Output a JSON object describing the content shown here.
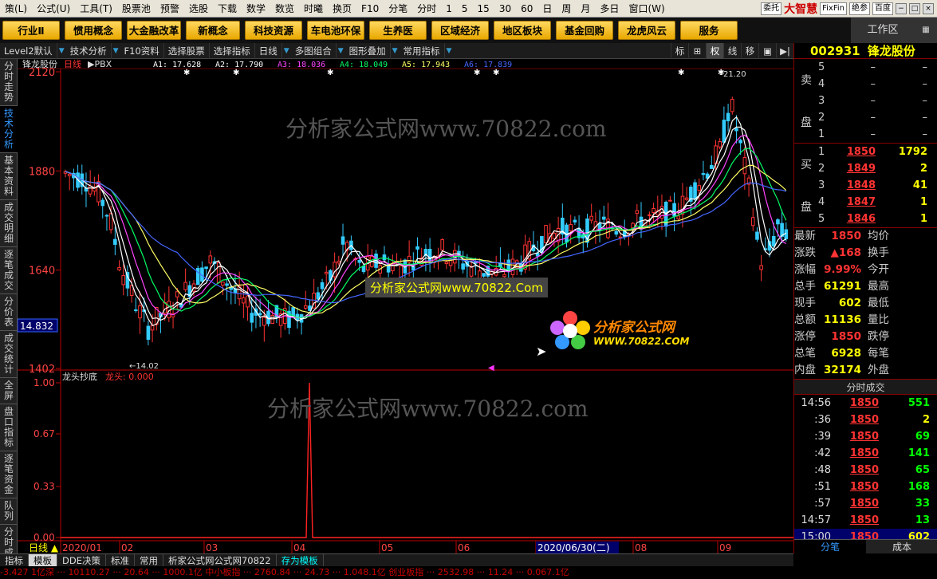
{
  "menu": [
    "策(L)",
    "公式(U)",
    "工具(T)",
    "股票池",
    "预警",
    "选股",
    "下载",
    "数学",
    "数览",
    "时曦",
    "换页",
    "F10",
    "分笔",
    "分时",
    "1",
    "5",
    "15",
    "30",
    "60",
    "日",
    "周",
    "月",
    "多日",
    "窗口(W)"
  ],
  "menu_badges": [
    "委托",
    "大智慧",
    "FixFin",
    "绝参",
    "百度"
  ],
  "toolbar": [
    "行业Ⅱ",
    "惯用概念",
    "大金融改革",
    "新概念",
    "科技资源",
    "车电池环保",
    "生养医",
    "区域经济",
    "地区板块",
    "基金回购",
    "龙虎风云",
    "服务"
  ],
  "workspace": "工作区",
  "subbar": {
    "items": [
      "Level2默认",
      "技术分析",
      "F10资料",
      "选择股票",
      "选择指标",
      "日线",
      "多图组合",
      "图形叠加",
      "常用指标"
    ],
    "right_buttons": [
      "标",
      "⊞",
      "权",
      "线",
      "移",
      "▣",
      "▶|"
    ]
  },
  "left_tabs": [
    "分时走势",
    "技术分析",
    "基本资料",
    "成交明细",
    "逐笔成交",
    "分价表",
    "成交统计",
    "全屏",
    "盘口指标",
    "逐笔资金",
    "队列",
    "分时成交"
  ],
  "chart": {
    "stock_name": "锋龙股份",
    "period": "日线",
    "indicator": "PBX",
    "ma_legend": [
      {
        "label": "A1: 17.628",
        "color": "#ffffff"
      },
      {
        "label": "A2: 17.790",
        "color": "#ffffff"
      },
      {
        "label": "A3: 18.036",
        "color": "#ff44ff"
      },
      {
        "label": "A4: 18.049",
        "color": "#00ff66"
      },
      {
        "label": "A5: 17.943",
        "color": "#ffff66"
      },
      {
        "label": "A6: 17.839",
        "color": "#4466ff"
      }
    ],
    "price_axis": [
      "2120",
      "1880",
      "1640",
      "1402"
    ],
    "current_price_tag": "14.832",
    "high_label": "21.20",
    "low_label": "14.02",
    "date_axis": [
      "2020/01",
      "02",
      "03",
      "04",
      "05",
      "06",
      "07",
      "08",
      "09"
    ],
    "cursor_date": "2020/06/30(二)",
    "sub_title": "龙头抄底",
    "sub_indicator": "龙头: 0.000",
    "sub_axis": [
      "1.00",
      "0.67",
      "0.33",
      "0.00"
    ],
    "period_label": "日线"
  },
  "chart_data": {
    "type": "candlestick",
    "title": "锋龙股份 日线 PBX",
    "ylim": [
      14.02,
      21.2
    ],
    "x": [
      "2020/01",
      "02",
      "03",
      "04",
      "05",
      "06",
      "07",
      "08",
      "09"
    ],
    "series": [
      {
        "name": "A1",
        "value": 17.628
      },
      {
        "name": "A2",
        "value": 17.79
      },
      {
        "name": "A3",
        "value": 18.036
      },
      {
        "name": "A4",
        "value": 18.049
      },
      {
        "name": "A5",
        "value": 17.943
      },
      {
        "name": "A6",
        "value": 17.839
      }
    ],
    "sub_chart": {
      "type": "line",
      "name": "龙头",
      "ylim": [
        0,
        1
      ],
      "values_note": "single spike to 1.00 in early April"
    }
  },
  "watermarks": {
    "main": "分析家公式网www.70822.com",
    "box": "分析家公式网www.70822.Com",
    "logo_title": "分析家公式网",
    "logo_url": "WWW.70822.COM"
  },
  "quote": {
    "code": "002931",
    "name": "锋龙股份",
    "sell_label": [
      "卖",
      "盘"
    ],
    "buy_label": [
      "买",
      "盘"
    ],
    "sell": [
      {
        "lv": "5",
        "price": "–",
        "vol": "–"
      },
      {
        "lv": "4",
        "price": "–",
        "vol": "–"
      },
      {
        "lv": "3",
        "price": "–",
        "vol": "–"
      },
      {
        "lv": "2",
        "price": "–",
        "vol": "–"
      },
      {
        "lv": "1",
        "price": "–",
        "vol": "–"
      }
    ],
    "buy": [
      {
        "lv": "1",
        "price": "1850",
        "vol": "1792"
      },
      {
        "lv": "2",
        "price": "1849",
        "vol": "2"
      },
      {
        "lv": "3",
        "price": "1848",
        "vol": "41"
      },
      {
        "lv": "4",
        "price": "1847",
        "vol": "1"
      },
      {
        "lv": "5",
        "price": "1846",
        "vol": "1"
      }
    ],
    "stats": [
      {
        "k": "最新",
        "v": "1850",
        "vc": "red",
        "k2": "均价"
      },
      {
        "k": "涨跌",
        "v": "▲168",
        "vc": "red",
        "k2": "换手"
      },
      {
        "k": "涨幅",
        "v": "9.99%",
        "vc": "red",
        "k2": "今开"
      },
      {
        "k": "总手",
        "v": "61291",
        "vc": "yel",
        "k2": "最高"
      },
      {
        "k": "现手",
        "v": "602",
        "vc": "yel",
        "k2": "最低"
      },
      {
        "k": "总额",
        "v": "11136",
        "vc": "yel",
        "k2": "量比"
      },
      {
        "k": "涨停",
        "v": "1850",
        "vc": "red",
        "k2": "跌停"
      },
      {
        "k": "总笔",
        "v": "6928",
        "vc": "yel",
        "k2": "每笔"
      },
      {
        "k": "内盘",
        "v": "32174",
        "vc": "yel",
        "k2": "外盘"
      }
    ],
    "trades_title": "分时成交",
    "trades": [
      {
        "t": "14:56",
        "p": "1850",
        "q": "551",
        "qc": "grn"
      },
      {
        "t": ":36",
        "p": "1850",
        "q": "2",
        "qc": "yel"
      },
      {
        "t": ":39",
        "p": "1850",
        "q": "69",
        "qc": "grn"
      },
      {
        "t": ":42",
        "p": "1850",
        "q": "141",
        "qc": "grn"
      },
      {
        "t": ":48",
        "p": "1850",
        "q": "65",
        "qc": "grn"
      },
      {
        "t": ":51",
        "p": "1850",
        "q": "168",
        "qc": "grn"
      },
      {
        "t": ":57",
        "p": "1850",
        "q": "33",
        "qc": "grn"
      },
      {
        "t": "14:57",
        "p": "1850",
        "q": "13",
        "qc": "grn"
      },
      {
        "t": "15:00",
        "p": "1850",
        "q": "602",
        "qc": "yel"
      }
    ],
    "bottom_tabs": [
      "分笔",
      "成本"
    ]
  },
  "bottom_tabs": [
    "指标",
    "模板",
    "DDE决策",
    "标准",
    "常用",
    "析家公式网公式网70822",
    "存为模板"
  ],
  "ticker": "-3.427 1亿深 ··· 10110.27 ··· 20.64 ··· 1000.1亿 中小板指 ··· 2760.84 ··· 24.73 ··· 1.048.1亿 创业板指 ··· 2532.98 ··· 11.24 ··· 0.067.1亿"
}
